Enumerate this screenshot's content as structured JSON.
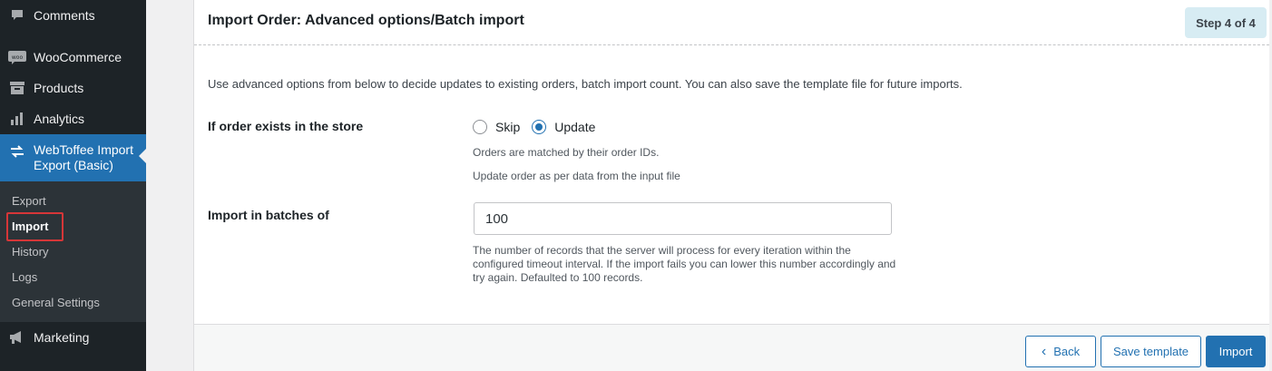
{
  "sidebar": {
    "menu": [
      {
        "label": "Comments",
        "icon": "comments-icon"
      },
      {
        "label": "WooCommerce",
        "icon": "woocommerce-icon"
      },
      {
        "label": "Products",
        "icon": "products-icon"
      },
      {
        "label": "Analytics",
        "icon": "analytics-icon"
      },
      {
        "label": "WebToffee Import Export (Basic)",
        "icon": "import-export-icon"
      },
      {
        "label": "Marketing",
        "icon": "megaphone-icon"
      }
    ],
    "submenu": [
      "Export",
      "Import",
      "History",
      "Logs",
      "General Settings"
    ],
    "current_submenu": "Import"
  },
  "page": {
    "title": "Import Order: Advanced options/Batch import",
    "step": "Step 4 of 4",
    "intro": "Use advanced options from below to decide updates to existing orders, batch import count. You can also save the template file for future imports."
  },
  "order_exists": {
    "label": "If order exists in the store",
    "options": [
      "Skip",
      "Update"
    ],
    "selected": "Update",
    "hint1": "Orders are matched by their order IDs.",
    "hint2": "Update order as per data from the input file"
  },
  "batch": {
    "label": "Import in batches of",
    "value": "100",
    "hint": "The number of records that the server will process for every iteration within the configured timeout interval. If the import fails you can lower this number accordingly and try again. Defaulted to 100 records."
  },
  "footer": {
    "back_label": "Back",
    "save_label": "Save template",
    "import_label": "Import"
  },
  "colors": {
    "accent": "#2271b1",
    "sidebar_bg": "#1d2327",
    "highlight_border": "#d63638",
    "step_badge_bg": "#d7ecf3"
  }
}
